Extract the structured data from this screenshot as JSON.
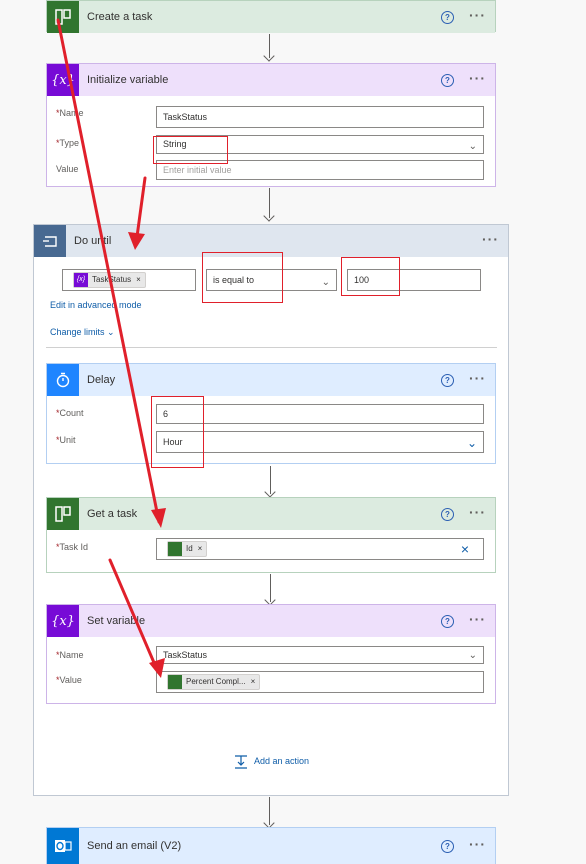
{
  "create_task": {
    "title": "Create a task"
  },
  "init_variable": {
    "title": "Initialize variable",
    "name_label": "Name",
    "name_value": "TaskStatus",
    "type_label": "Type",
    "type_value": "String",
    "value_label": "Value",
    "value_placeholder": "Enter initial value"
  },
  "do_until": {
    "title": "Do until",
    "condition_chip": "TaskStatus",
    "operator": "is equal to",
    "compare_value": "100",
    "advanced_link": "Edit in advanced mode",
    "limits_link": "Change limits"
  },
  "delay": {
    "title": "Delay",
    "count_label": "Count",
    "count_value": "6",
    "unit_label": "Unit",
    "unit_value": "Hour"
  },
  "get_task": {
    "title": "Get a task",
    "task_id_label": "Task Id",
    "task_id_chip": "Id"
  },
  "set_variable": {
    "title": "Set variable",
    "name_label": "Name",
    "name_value": "TaskStatus",
    "value_label": "Value",
    "value_chip": "Percent Compl..."
  },
  "add_action": {
    "label": "Add an action"
  },
  "send_email": {
    "title": "Send an email (V2)"
  },
  "symbols": {
    "help": "?",
    "more": "···",
    "required": "*",
    "close": "×",
    "variable_glyph": "{x}"
  },
  "colors": {
    "planner_green": "#31752f",
    "planner_header": "#dcebe0",
    "variable_purple": "#770bd6",
    "variable_header": "#eee0fb",
    "loop_blue": "#486991",
    "loop_header": "#dfe6ef",
    "delay_blue": "#1f85ff",
    "delay_header": "#dfedff",
    "outlook_blue": "#0078d4",
    "annotation_red": "#e0202b"
  }
}
